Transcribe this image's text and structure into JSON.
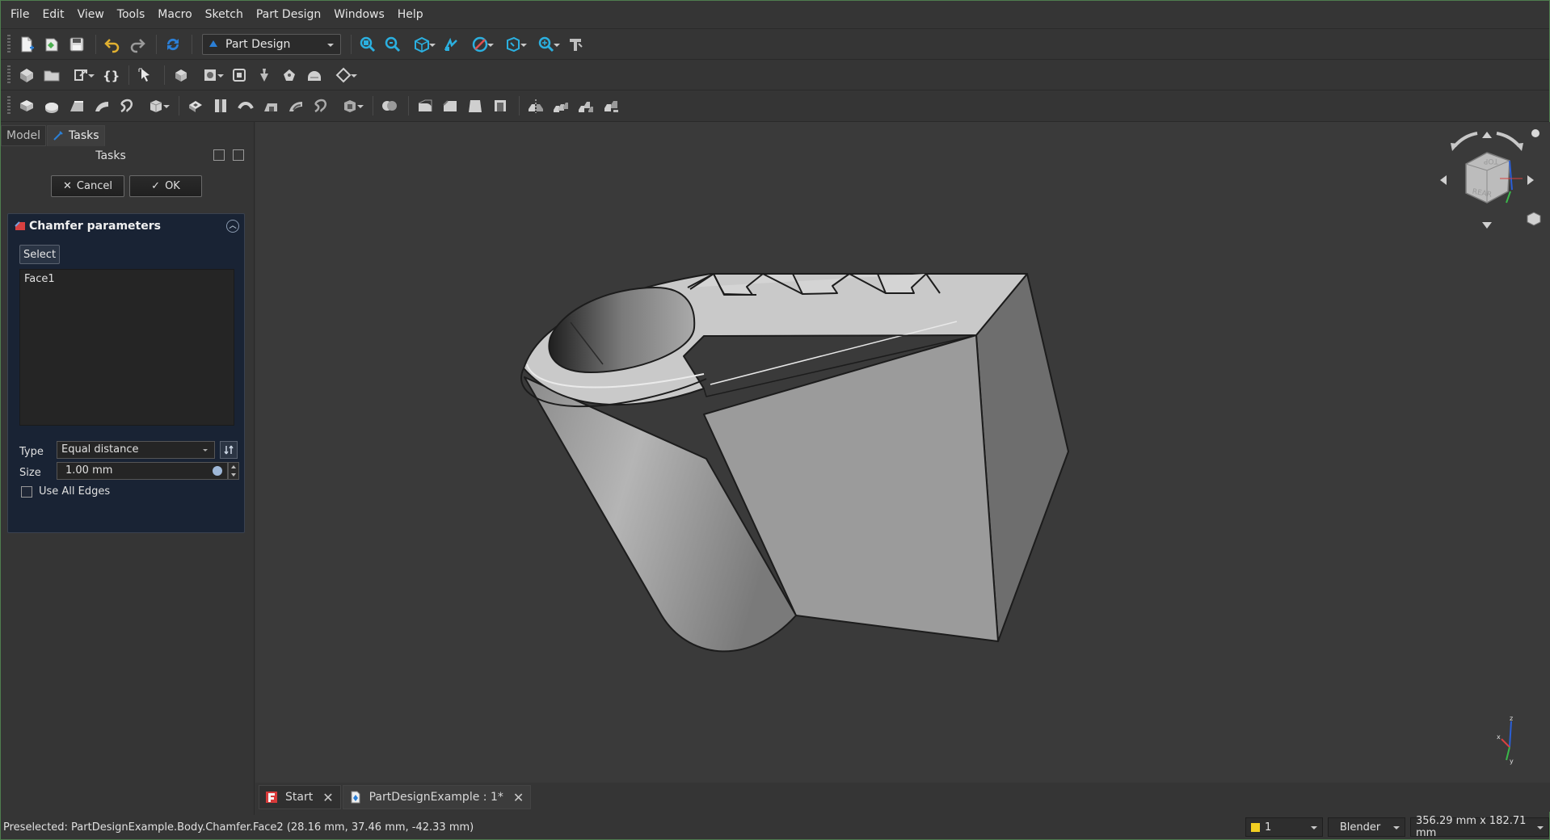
{
  "menu": [
    "File",
    "Edit",
    "View",
    "Tools",
    "Macro",
    "Sketch",
    "Part Design",
    "Windows",
    "Help"
  ],
  "workbench": {
    "selected": "Part Design",
    "icon": "partdesign-icon"
  },
  "toolbar_icons": {
    "row1": [
      "new-file-icon",
      "open-file-icon",
      "save-icon",
      "undo-icon",
      "redo-icon",
      "refresh-icon",
      "fit-all-icon",
      "fit-selection-icon",
      "view-cube-icon",
      "stereo-icon",
      "draw-style-icon",
      "bounding-box-icon",
      "measure-icon",
      "whats-this-icon"
    ],
    "row2": [
      "body-icon",
      "folder-icon",
      "link-icon",
      "braces-icon",
      "select-filter-icon",
      "shape-binder-icon",
      "sub-binder-icon",
      "clone-icon",
      "sketch-icon",
      "attach-icon",
      "datum-icon"
    ],
    "row3": [
      "pad-icon",
      "revolve-icon",
      "loft-icon",
      "pipe-icon",
      "helix-icon",
      "additive-primitive-icon",
      "pocket-icon",
      "hole-icon",
      "groove-icon",
      "subtractive-loft-icon",
      "subtractive-pipe-icon",
      "subtractive-helix-icon",
      "subtractive-primitive-icon",
      "boolean-icon",
      "fillet-icon",
      "chamfer-icon",
      "draft-icon",
      "thickness-icon",
      "mirror-icon",
      "linear-pattern-icon",
      "polar-pattern-icon",
      "multi-transform-icon"
    ]
  },
  "panel": {
    "tabs": [
      {
        "label": "Model"
      },
      {
        "label": "Tasks"
      }
    ],
    "title": "Tasks",
    "cancel_label": "Cancel",
    "ok_label": "OK",
    "taskbox": {
      "title": "Chamfer parameters",
      "select_label": "Select",
      "items": [
        "Face1"
      ],
      "type_label": "Type",
      "type_value": "Equal distance",
      "size_label": "Size",
      "size_value": "1.00 mm",
      "use_all_edges_label": "Use All Edges",
      "use_all_edges_checked": false
    }
  },
  "navcube": {
    "faces": [
      "TOP",
      "REAR"
    ]
  },
  "axis": {
    "x": "x",
    "y": "y",
    "z": "z"
  },
  "doc_tabs": [
    {
      "label": "Start",
      "active": false
    },
    {
      "label": "PartDesignExample : 1*",
      "active": true
    }
  ],
  "status": {
    "text": "Preselected: PartDesignExample.Body.Chamfer.Face2 (28.16 mm, 37.46 mm, -42.33 mm)",
    "layer": "1",
    "nav_style": "Blender",
    "dimensions": "356.29 mm x 182.71 mm"
  },
  "colors": {
    "accent": "#2b7fd6",
    "layer": "#f2cf22",
    "taskbox_bg": "#192334",
    "viewport_bg": "#3a3a3a"
  }
}
